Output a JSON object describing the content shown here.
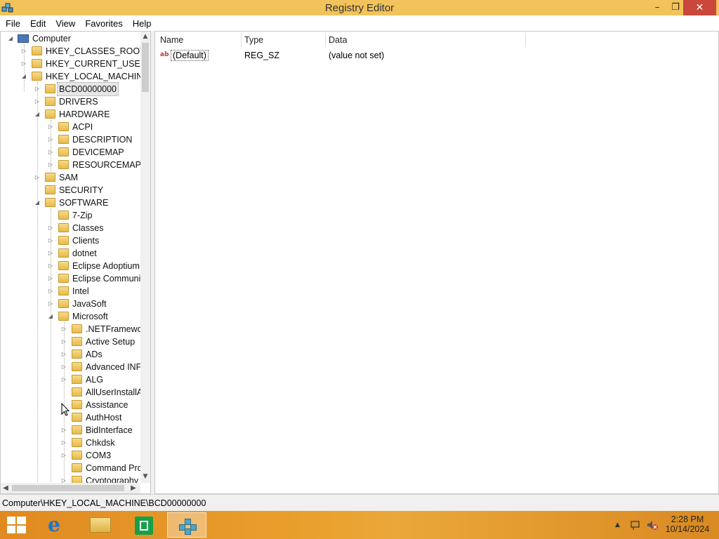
{
  "window": {
    "title": "Registry Editor",
    "minimize": "–",
    "maximize": "❐",
    "close": "✕"
  },
  "menu": [
    "File",
    "Edit",
    "View",
    "Favorites",
    "Help"
  ],
  "tree": {
    "root": "Computer",
    "hives": {
      "classes_root": "HKEY_CLASSES_ROOT",
      "current_user": "HKEY_CURRENT_USER",
      "local_machine": "HKEY_LOCAL_MACHINE"
    },
    "hklm_children": {
      "bcd": "BCD00000000",
      "drivers": "DRIVERS",
      "hardware": "HARDWARE",
      "sam": "SAM",
      "security": "SECURITY",
      "software": "SOFTWARE"
    },
    "hardware_children": [
      "ACPI",
      "DESCRIPTION",
      "DEVICEMAP",
      "RESOURCEMAP"
    ],
    "software_children": [
      "7-Zip",
      "Classes",
      "Clients",
      "dotnet",
      "Eclipse Adoptium",
      "Eclipse Communit",
      "Intel",
      "JavaSoft",
      "Microsoft"
    ],
    "microsoft_children": [
      ".NETFramewor",
      "Active Setup",
      "ADs",
      "Advanced INF",
      "ALG",
      "AllUserInstallA",
      "Assistance",
      "AuthHost",
      "BidInterface",
      "Chkdsk",
      "COM3",
      "Command Prc",
      "Cryptography"
    ]
  },
  "values": {
    "columns": {
      "name": "Name",
      "type": "Type",
      "data": "Data"
    },
    "rows": [
      {
        "icon": "ab",
        "name": "(Default)",
        "type": "REG_SZ",
        "data": "(value not set)"
      }
    ]
  },
  "status": {
    "path": "Computer\\HKEY_LOCAL_MACHINE\\BCD00000000"
  },
  "taskbar": {
    "time": "2:28 PM",
    "date": "10/14/2024",
    "tray_expand": "▲",
    "ie_glyph": "e"
  },
  "colors": {
    "titlebar": "#f2c35a",
    "close_button": "#c9473b",
    "taskbar": "#e08a20",
    "store": "#17a049"
  }
}
